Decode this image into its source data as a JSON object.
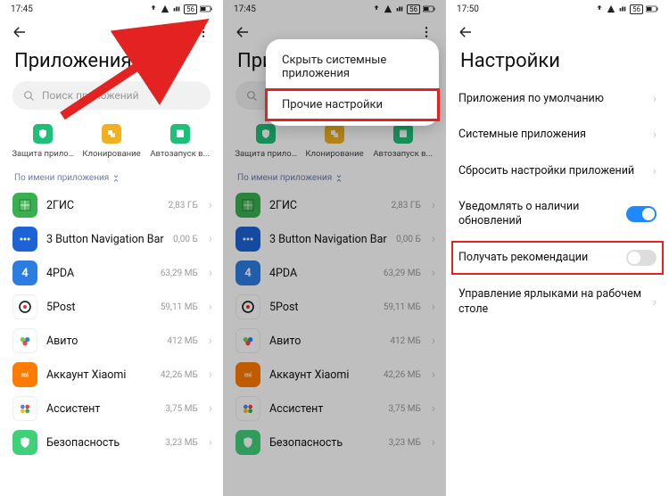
{
  "screen1": {
    "time": "17:45",
    "title": "Приложения",
    "search_placeholder": "Поиск приложений",
    "categories": [
      {
        "label": "Защита прило...",
        "color": "#1fbf7a"
      },
      {
        "label": "Клонирование",
        "color": "#f0b020"
      },
      {
        "label": "Автозапуск в...",
        "color": "#1fbf7a"
      }
    ],
    "sort_label": "По имени приложения",
    "apps": [
      {
        "name": "2ГИС",
        "size": "2,83 ГБ",
        "bg": "#38b050"
      },
      {
        "name": "3 Button Navigation Bar",
        "size": "0,00 Б",
        "bg": "#1e63d6"
      },
      {
        "name": "4PDA",
        "size": "63,29 МБ",
        "bg": "#2c7de0"
      },
      {
        "name": "5Post",
        "size": "59,11 МБ",
        "bg": "#ffffff"
      },
      {
        "name": "Авито",
        "size": "412 МБ",
        "bg": "#ffffff"
      },
      {
        "name": "Аккаунт Xiaomi",
        "size": "42,26 МБ",
        "bg": "#ff7a00"
      },
      {
        "name": "Ассистент",
        "size": "3,75 МБ",
        "bg": "#ffffff"
      },
      {
        "name": "Безопасность",
        "size": "3,23 МБ",
        "bg": "#3fd07a"
      }
    ]
  },
  "screen2": {
    "time": "17:45",
    "title_partial": "При",
    "menu": [
      "Скрыть системные приложения",
      "Прочие настройки"
    ]
  },
  "screen3": {
    "time": "17:50",
    "title": "Настройки",
    "rows": [
      {
        "label": "Приложения по умолчанию",
        "type": "nav"
      },
      {
        "label": "Системные приложения",
        "type": "nav"
      },
      {
        "label": "Сбросить настройки приложений",
        "type": "nav"
      },
      {
        "label": "Уведомлять о наличии обновлений",
        "type": "toggle",
        "on": true
      },
      {
        "label": "Получать рекомендации",
        "type": "toggle",
        "on": false,
        "highlight": true
      },
      {
        "label": "Управление ярлыками на рабочем столе",
        "type": "nav"
      }
    ]
  }
}
